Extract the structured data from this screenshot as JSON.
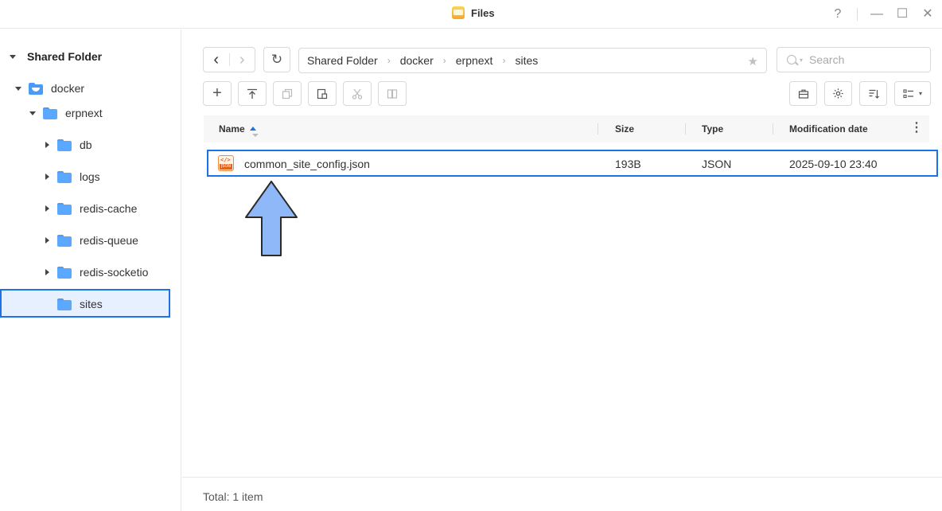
{
  "window": {
    "title": "Files",
    "controls": {
      "help": "?",
      "minimize": "—",
      "maximize": "☐",
      "close": "✕"
    }
  },
  "sidebar": {
    "root_label": "Shared Folder",
    "items": [
      {
        "label": "docker",
        "level": 0,
        "expanded": true,
        "icon": "docker-folder-icon"
      },
      {
        "label": "erpnext",
        "level": 1,
        "expanded": true,
        "icon": "folder-icon"
      },
      {
        "label": "db",
        "level": 2,
        "expanded": false,
        "icon": "folder-icon"
      },
      {
        "label": "logs",
        "level": 2,
        "expanded": false,
        "icon": "folder-icon"
      },
      {
        "label": "redis-cache",
        "level": 2,
        "expanded": false,
        "icon": "folder-icon"
      },
      {
        "label": "redis-queue",
        "level": 2,
        "expanded": false,
        "icon": "folder-icon"
      },
      {
        "label": "redis-socketio",
        "level": 2,
        "expanded": false,
        "icon": "folder-icon"
      },
      {
        "label": "sites",
        "level": 2,
        "expanded": false,
        "selected": true,
        "icon": "folder-icon"
      }
    ]
  },
  "toolbar": {
    "back": "‹",
    "forward": "›",
    "refresh": "↻",
    "breadcrumb": [
      "Shared Folder",
      "docker",
      "erpnext",
      "sites"
    ],
    "search_placeholder": "Search"
  },
  "table": {
    "columns": [
      "Name",
      "Size",
      "Type",
      "Modification date"
    ],
    "rows": [
      {
        "name": "common_site_config.json",
        "size": "193B",
        "type": "JSON",
        "modified": "2025-09-10 23:40"
      }
    ]
  },
  "status": {
    "total": "Total: 1 item"
  },
  "colors": {
    "accent": "#1a73e8",
    "folder": "#5aa9ff",
    "arrow": "#8fb8f8"
  }
}
